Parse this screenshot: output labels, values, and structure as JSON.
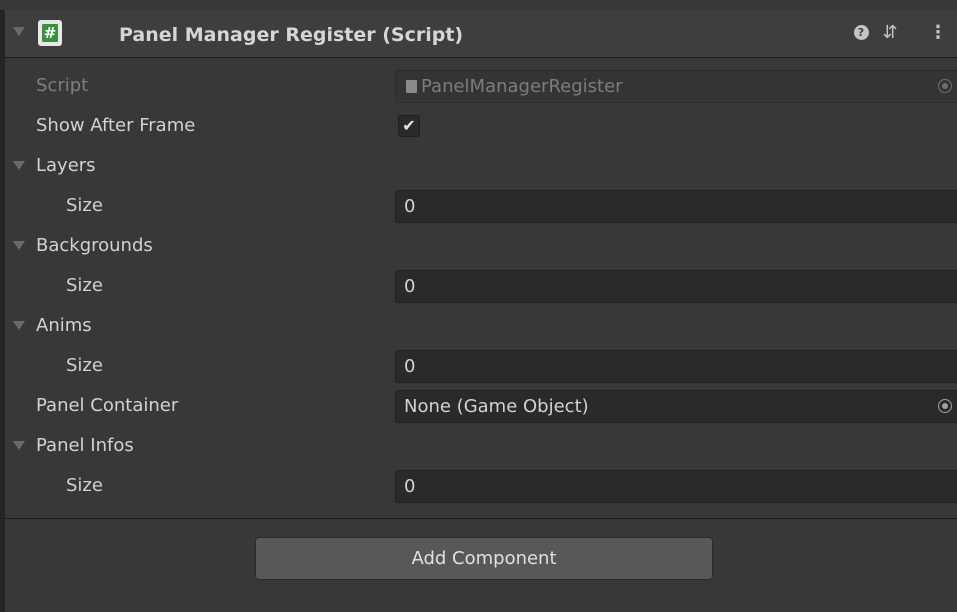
{
  "component": {
    "title": "Panel Manager Register (Script)",
    "script_icon_glyph": "#",
    "header_icons": [
      "help-icon",
      "presets-icon",
      "menu-icon"
    ],
    "help_glyph": "?",
    "presets_glyph": "⇵",
    "menu_glyph": "⋮"
  },
  "rows": {
    "script": {
      "label": "Script",
      "value": "PanelManagerRegister"
    },
    "show_after_frame": {
      "label": "Show After Frame",
      "checked": true,
      "check_glyph": "✔"
    },
    "layers": {
      "label": "Layers",
      "size_label": "Size",
      "size_value": "0"
    },
    "backgrounds": {
      "label": "Backgrounds",
      "size_label": "Size",
      "size_value": "0"
    },
    "anims": {
      "label": "Anims",
      "size_label": "Size",
      "size_value": "0"
    },
    "panel_container": {
      "label": "Panel Container",
      "value": "None (Game Object)"
    },
    "panel_infos": {
      "label": "Panel Infos",
      "size_label": "Size",
      "size_value": "0"
    }
  },
  "footer": {
    "add_component_label": "Add Component"
  },
  "colors": {
    "background": "#383838",
    "field": "#2a2a2a",
    "button": "#585858",
    "script_icon_green": "#3b8f3e"
  }
}
